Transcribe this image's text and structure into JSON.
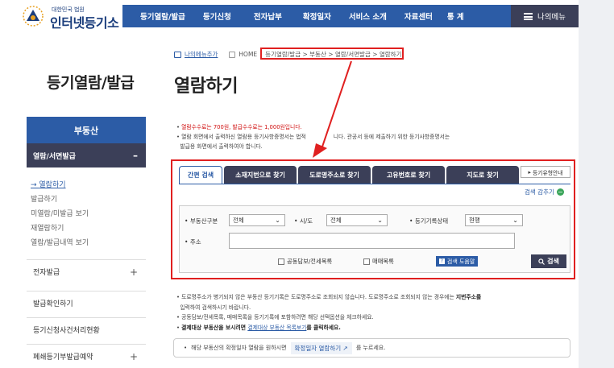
{
  "header": {
    "logo_small": "대한민국 법원",
    "logo_big": "인터넷등기소",
    "nav": [
      "등기열람/발급",
      "등기신청",
      "전자납부",
      "확정일자",
      "서비스 소개",
      "자료센터",
      "통 계"
    ],
    "my_menu": "나의메뉴"
  },
  "sidebar": {
    "title": "등기열람/발급",
    "category": "부동산",
    "active_section": "열람/서면발급",
    "active_toggle": "–",
    "sub_items": [
      "열람하기",
      "발급하기",
      "미열람/미발급 보기",
      "재열람하기",
      "열람/발급내역 보기"
    ],
    "items": [
      {
        "label": "전자발급",
        "toggle": "+"
      },
      {
        "label": "발급확인하기",
        "toggle": ""
      },
      {
        "label": "등기신청사건처리현황",
        "toggle": ""
      },
      {
        "label": "폐쇄등기부발급예약",
        "toggle": "+"
      }
    ]
  },
  "breadcrumb": {
    "add_menu": "나의메뉴추가",
    "home": "HOME",
    "path": "등기열람/발급 > 부동산 > 열람/서면발급 > 열람하기"
  },
  "page_title": "열람하기",
  "notes": {
    "line1": "열람수수료는 700원, 발급수수료는 1,000원입니다.",
    "line2_a": "열람 회면에서 출력하신 열람용 등기사항증명서는 법적",
    "line2_b": "니다. 관공서 등에 제출하기 위한 등기사항증명서는",
    "line3": "발급용 화면에서 출력하여야 합니다."
  },
  "tabs": [
    "간편 검색",
    "소재지번으로 찾기",
    "도로명주소로 찾기",
    "고유번호로 찾기",
    "지도로 찾기"
  ],
  "guide_button": "등기유형안내",
  "hide_conditions": "검색 감추기",
  "form": {
    "property_type_label": "부동산구분",
    "property_type_value": "전체",
    "sido_label": "시/도",
    "sido_value": "전체",
    "record_status_label": "등기기록상태",
    "record_status_value": "현행",
    "address_label": "주소",
    "address_value": "",
    "checkbox1": "공동담보/전세목록",
    "checkbox2": "매매목록",
    "help_button": "검색 도움말",
    "search_button": "검색"
  },
  "notes2": {
    "line1_a": "도로명주소가 병기되지 않은 부동산 등기기록은 도로명주소로 조회되지 않습니다. 도로명주소로 조회되지 않는 경우에는 ",
    "line1_b": "지번주소를",
    "line2": "입력하여 검색하시기 바랍니다.",
    "line3": "공동담보/전세목록, 매매목록을 등기기록에 포함하려면 해당 선택옵션을 체크하세요.",
    "line4_a": "결제대상 부동산을 보시려면 ",
    "line4_link": "결제대상 부동산 목록보기",
    "line4_b": "를 클릭하세요."
  },
  "infobox": {
    "text_a": "해당 부동산의 확정일자 열람을 원하시면",
    "button": "확정일자 열람하기",
    "text_b": "를 누르세요."
  },
  "colors": {
    "nav_blue": "#2c5ca6",
    "dark_navy": "#3b3f58",
    "highlight_red": "#e02020"
  }
}
